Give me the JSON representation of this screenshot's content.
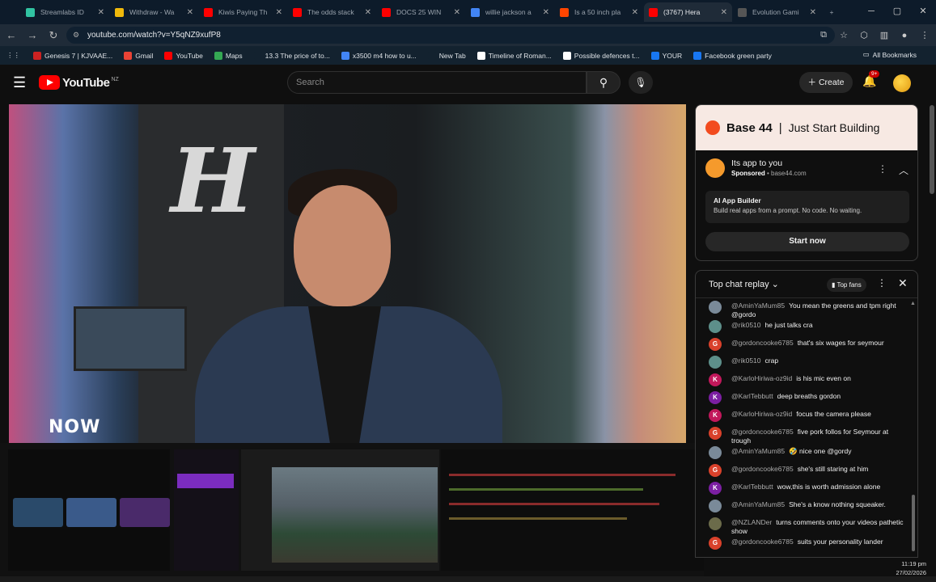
{
  "browser": {
    "tabs": [
      {
        "label": "Streamlabs ID",
        "color": "#31c3a2"
      },
      {
        "label": "Withdraw - Wa",
        "color": "#f0b90b"
      },
      {
        "label": "Kiwis Paying Th",
        "color": "#ff0000"
      },
      {
        "label": "The odds stack",
        "color": "#ff0000"
      },
      {
        "label": "DOCS 25 WIN",
        "color": "#ff0000"
      },
      {
        "label": "willie jackson a",
        "color": "#4285f4"
      },
      {
        "label": "Is a 50 inch pla",
        "color": "#ff4500"
      },
      {
        "label": "(3767) Hera",
        "color": "#ff0000"
      },
      {
        "label": "Evolution Gami",
        "color": "#555555"
      }
    ],
    "url": "youtube.com/watch?v=Y5qNZ9xufP8",
    "bookmarks": [
      {
        "label": "Genesis 7 | KJVAAE...",
        "color": "#cc2222"
      },
      {
        "label": "Gmail",
        "color": "#ea4335"
      },
      {
        "label": "YouTube",
        "color": "#ff0000"
      },
      {
        "label": "Maps",
        "color": "#34a853"
      },
      {
        "label": "13.3 The price of to...",
        "color": "#13222f"
      },
      {
        "label": "x3500 m4 how to u...",
        "color": "#4285f4"
      },
      {
        "label": "New Tab",
        "color": "#13222f"
      },
      {
        "label": "Timeline of Roman...",
        "color": "#ffffff"
      },
      {
        "label": "Possible defences t...",
        "color": "#ffffff"
      },
      {
        "label": "YOUR",
        "color": "#1877f2"
      },
      {
        "label": "Facebook green party",
        "color": "#1877f2"
      }
    ],
    "all_bookmarks": "All Bookmarks"
  },
  "youtube": {
    "region": "NZ",
    "brand": "YouTube",
    "search_placeholder": "Search",
    "create_label": "Create",
    "notif_count": "9+"
  },
  "video": {
    "overlay_text": "NOW"
  },
  "ad": {
    "brand": "Base 44",
    "slogan": "Just Start Building",
    "title": "Its app to you",
    "sponsored": "Sponsored",
    "domain": "base44.com",
    "card_title": "AI App Builder",
    "card_desc": "Build real apps from a prompt. No code. No waiting.",
    "cta": "Start now"
  },
  "chat": {
    "title": "Top chat replay",
    "top_fans": "Top fans",
    "messages": [
      {
        "author": "@AminYaMum85",
        "text": "You mean the greens and tpm right @gordo",
        "av": "",
        "color": "#7a8a99"
      },
      {
        "author": "@rik0510",
        "text": "he just talks cra",
        "av": "",
        "color": "#5d8f8a"
      },
      {
        "author": "@gordoncooke6785",
        "text": "that's six wages for seymour",
        "av": "G",
        "color": "#d9412b"
      },
      {
        "author": "@rik0510",
        "text": "crap",
        "av": "",
        "color": "#5d8f8a"
      },
      {
        "author": "@KarloHiriwa-oz9id",
        "text": "is his mic even on",
        "av": "K",
        "color": "#c2185b"
      },
      {
        "author": "@KarlTebbutt",
        "text": "deep breaths gordon",
        "av": "K",
        "color": "#7b1fa2"
      },
      {
        "author": "@KarloHiriwa-oz9id",
        "text": "focus the camera please",
        "av": "K",
        "color": "#c2185b"
      },
      {
        "author": "@gordoncooke6785",
        "text": "five pork follos for Seymour at trough",
        "av": "G",
        "color": "#d9412b"
      },
      {
        "author": "@AminYaMum85",
        "text": "🤣 nice one @gordy",
        "av": "",
        "color": "#7a8a99"
      },
      {
        "author": "@gordoncooke6785",
        "text": "she's still staring at him",
        "av": "G",
        "color": "#d9412b"
      },
      {
        "author": "@KarlTebbutt",
        "text": "wow,this is worth admission alone",
        "av": "K",
        "color": "#7b1fa2"
      },
      {
        "author": "@AminYaMum85",
        "text": "She's a know nothing squeaker.",
        "av": "",
        "color": "#7a8a99"
      },
      {
        "author": "@NZLANDer",
        "text": "turns comments onto your videos pathetic show",
        "av": "",
        "color": "#6b6b4a"
      },
      {
        "author": "@gordoncooke6785",
        "text": "suits your personality lander",
        "av": "G",
        "color": "#d9412b"
      }
    ]
  },
  "taskbar": {
    "time": "11:19 pm",
    "date": "27/02/2026"
  }
}
